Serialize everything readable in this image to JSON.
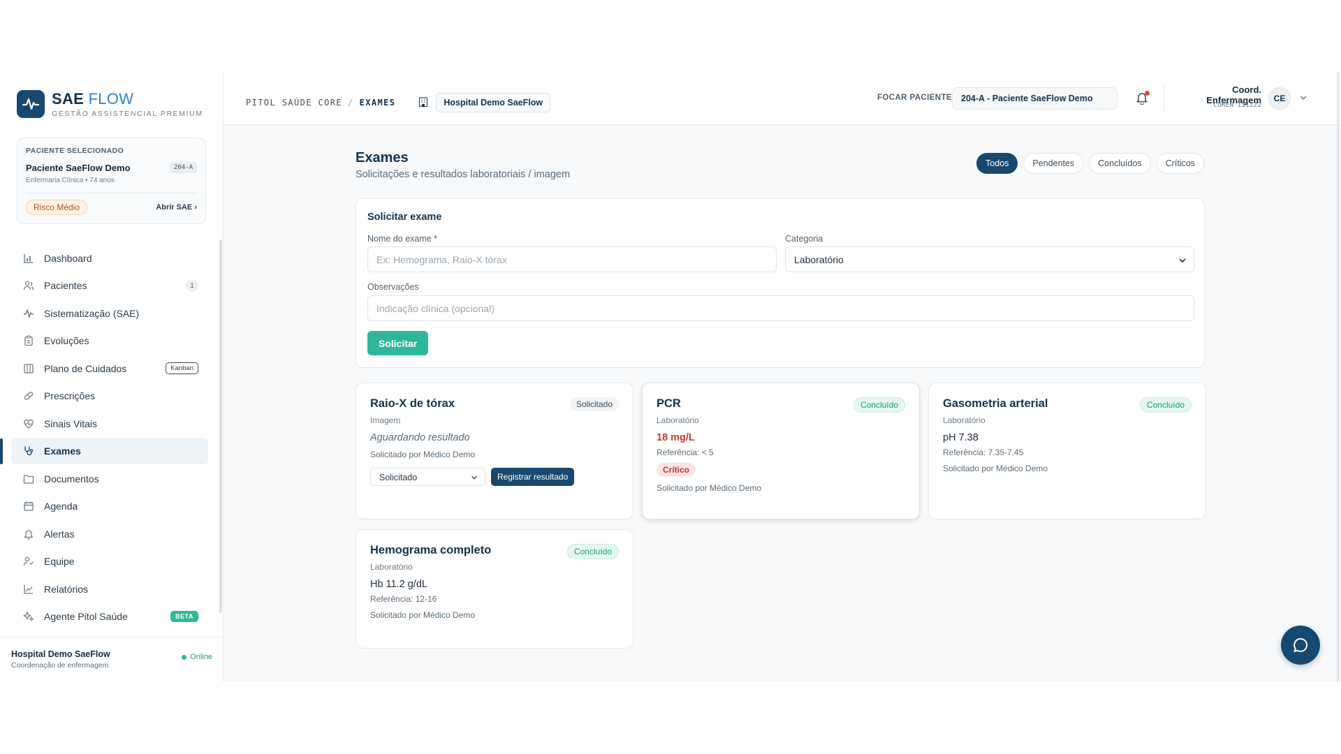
{
  "brand": {
    "name_primary": "SAE",
    "name_secondary": "FLOW",
    "tagline": "GESTÃO ASSISTENCIAL PREMIUM"
  },
  "patient_card": {
    "label": "PACIENTE SELECIONADO",
    "name": "Paciente SaeFlow Demo",
    "bed": "204-A",
    "meta": "Enfermaria Clínica • 74 anos",
    "risk": "Risco Médio",
    "open_link": "Abrir SAE"
  },
  "nav": {
    "items": [
      {
        "label": "Dashboard",
        "icon": "bar-chart-icon"
      },
      {
        "label": "Pacientes",
        "icon": "users-icon",
        "count": "1"
      },
      {
        "label": "Sistematização (SAE)",
        "icon": "pulse-icon"
      },
      {
        "label": "Evoluções",
        "icon": "clipboard-icon"
      },
      {
        "label": "Plano de Cuidados",
        "icon": "board-icon",
        "tag": "Kanban"
      },
      {
        "label": "Prescrições",
        "icon": "pill-icon"
      },
      {
        "label": "Sinais Vitais",
        "icon": "heart-pulse-icon"
      },
      {
        "label": "Exames",
        "icon": "stethoscope-icon",
        "active": true
      },
      {
        "label": "Documentos",
        "icon": "folder-icon"
      },
      {
        "label": "Agenda",
        "icon": "calendar-icon"
      },
      {
        "label": "Alertas",
        "icon": "bell-icon"
      },
      {
        "label": "Equipe",
        "icon": "team-icon"
      },
      {
        "label": "Relatórios",
        "icon": "line-chart-icon"
      },
      {
        "label": "Agente Pitol Saúde",
        "icon": "sparkles-icon",
        "tag": "BETA"
      }
    ]
  },
  "sidebar_footer": {
    "title": "Hospital Demo SaeFlow",
    "subtitle": "Coordenação de enfermagem",
    "status": "Online"
  },
  "header": {
    "crumb_root": "PITOL SAÚDE CORE",
    "crumb_sep": "/",
    "crumb_current": "EXAMES",
    "hospital": "Hospital Demo SaeFlow",
    "focus_label": "FOCAR PACIENTE:",
    "focus_value": "204-A - Paciente SaeFlow Demo",
    "user_name": "Coord. Enfermagem",
    "user_coren": "COREN 111222",
    "user_initials": "CE"
  },
  "page": {
    "title": "Exames",
    "subtitle": "Solicitações e resultados laboratoriais / imagem"
  },
  "filters": [
    "Todos",
    "Pendentes",
    "Concluídos",
    "Críticos"
  ],
  "form": {
    "title": "Solicitar exame",
    "name_label": "Nome do exame *",
    "name_placeholder": "Ex: Hemograma, Raio-X tórax",
    "category_label": "Categoria",
    "category_value": "Laboratório",
    "notes_label": "Observações",
    "notes_placeholder": "Indicação clínica (opcional)",
    "submit": "Solicitar"
  },
  "exams": [
    {
      "title": "Raio-X de tórax",
      "status": "Solicitado",
      "category": "Imagem",
      "result": "Aguardando resultado",
      "requested_by": "Solicitado por Médico Demo",
      "select_value": "Solicitado",
      "action": "Registrar resultado"
    },
    {
      "title": "PCR",
      "status": "Concluído",
      "category": "Laboratório",
      "result": "18 mg/L",
      "reference": "Referência: < 5",
      "flag": "Crítico",
      "requested_by": "Solicitado por Médico Demo"
    },
    {
      "title": "Gasometria arterial",
      "status": "Concluído",
      "category": "Laboratório",
      "result": "pH 7.38",
      "reference": "Referência: 7.35-7.45",
      "requested_by": "Solicitado por Médico Demo"
    },
    {
      "title": "Hemograma completo",
      "status": "Concluído",
      "category": "Laboratório",
      "result": "Hb 11.2 g/dL",
      "reference": "Referência: 12-16",
      "requested_by": "Solicitado por Médico Demo"
    }
  ],
  "colors": {
    "primary": "#17486f",
    "accent": "#2fb79a",
    "critical": "#c0392b"
  }
}
